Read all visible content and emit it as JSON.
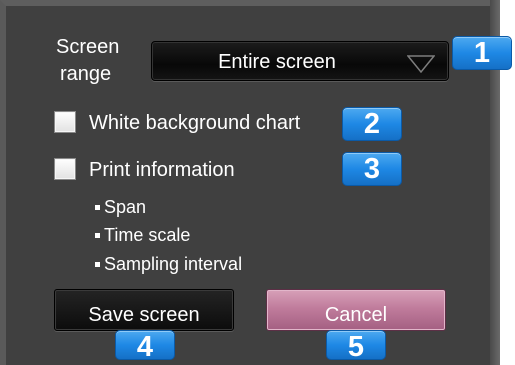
{
  "screen_range": {
    "label_line1": "Screen",
    "label_line2": "range",
    "selected": "Entire screen"
  },
  "options": {
    "white_background_chart": {
      "label": "White background chart",
      "checked": false
    },
    "print_information": {
      "label": "Print information",
      "checked": false,
      "items": [
        "Span",
        "Time scale",
        "Sampling interval"
      ]
    }
  },
  "buttons": {
    "save_label": "Save screen",
    "cancel_label": "Cancel"
  },
  "callouts": [
    "1",
    "2",
    "3",
    "4",
    "5"
  ],
  "colors": {
    "panel_bg": "#404040",
    "cancel_button": "#c07c9c",
    "callout_badge": "#1e88e5"
  }
}
